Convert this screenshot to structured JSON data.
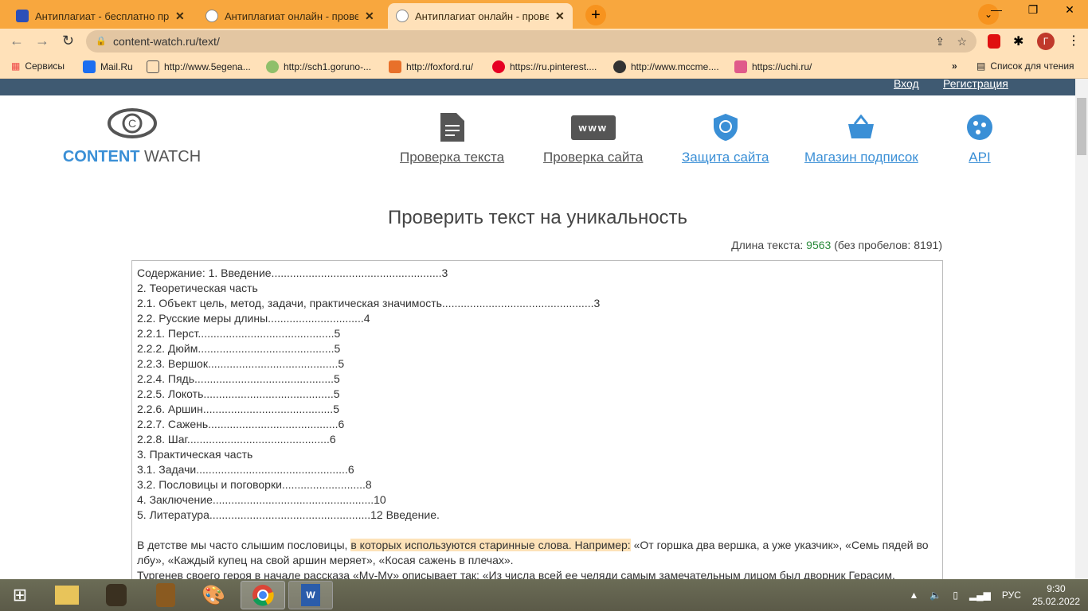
{
  "browser": {
    "tabs": [
      {
        "title": "Антиплагиат - бесплатно прове",
        "active": false
      },
      {
        "title": "Антиплагиат онлайн - проверит",
        "active": false
      },
      {
        "title": "Антиплагиат онлайн - проверит",
        "active": true
      }
    ],
    "url": "content-watch.ru/text/",
    "bookmarks": [
      "Сервисы",
      "Mail.Ru",
      "http://www.5egena...",
      "http://sch1.goruno-...",
      "http://foxford.ru/",
      "https://ru.pinterest....",
      "http://www.mccme....",
      "https://uchi.ru/"
    ],
    "reading_list": "Список для чтения",
    "profile_initial": "Г",
    "accent": "#f8a73e"
  },
  "site": {
    "header_links": {
      "login": "Вход",
      "register": "Регистрация"
    },
    "logo": {
      "part1": "CONTENT",
      "part2": " WATCH"
    },
    "nav": [
      {
        "label": "Проверка текста",
        "icon": "document-icon"
      },
      {
        "label": "Проверка сайта",
        "icon": "www-icon",
        "icon_text": "www"
      },
      {
        "label": "Защита сайта",
        "icon": "shield-icon"
      },
      {
        "label": "Магазин подписок",
        "icon": "basket-icon"
      },
      {
        "label": "API",
        "icon": "api-icon"
      }
    ],
    "title": "Проверить текст на уникальность",
    "length": {
      "label": "Длина текста: ",
      "value": "9563",
      "nospace": " (без пробелов: 8191)"
    },
    "text_lines": [
      "Содержание: 1. Введение.......................................................3",
      "2. Теоретическая часть",
      "2.1. Объект цель, метод, задачи, практическая значимость.................................................3",
      "2.2. Русские меры длины...............................4",
      "2.2.1. Перст............................................5",
      "2.2.2. Дюйм............................................5",
      "2.2.3. Вершок..........................................5",
      "2.2.4. Пядь.............................................5",
      "2.2.5. Локоть..........................................5",
      "2.2.6. Аршин..........................................5",
      "2.2.7. Сажень..........................................6",
      "2.2.8. Шаг..............................................6",
      "3. Практическая часть",
      "3.1. Задачи.................................................6",
      "3.2. Пословицы и поговорки...........................8",
      "4. Заключение....................................................10",
      "5. Литература....................................................12 Введение."
    ],
    "para1": {
      "before": "В детстве мы часто слышим пословицы, ",
      "highlight": "в которых используются старинные слова. Например:",
      "after": " «От горшка два вершка, а уже указчик», «Семь пядей во лбу», «Каждый купец на свой аршин меряет», «Косая сажень в плечах»."
    },
    "para2": "Тургенев своего героя в начале рассказа «Му-Му» описывает так: «Из числа всей ее челяди самым замечательным лицом был дворник Герасим,"
  },
  "taskbar": {
    "lang": "РУС",
    "time": "9:30",
    "date": "25.02.2022"
  }
}
